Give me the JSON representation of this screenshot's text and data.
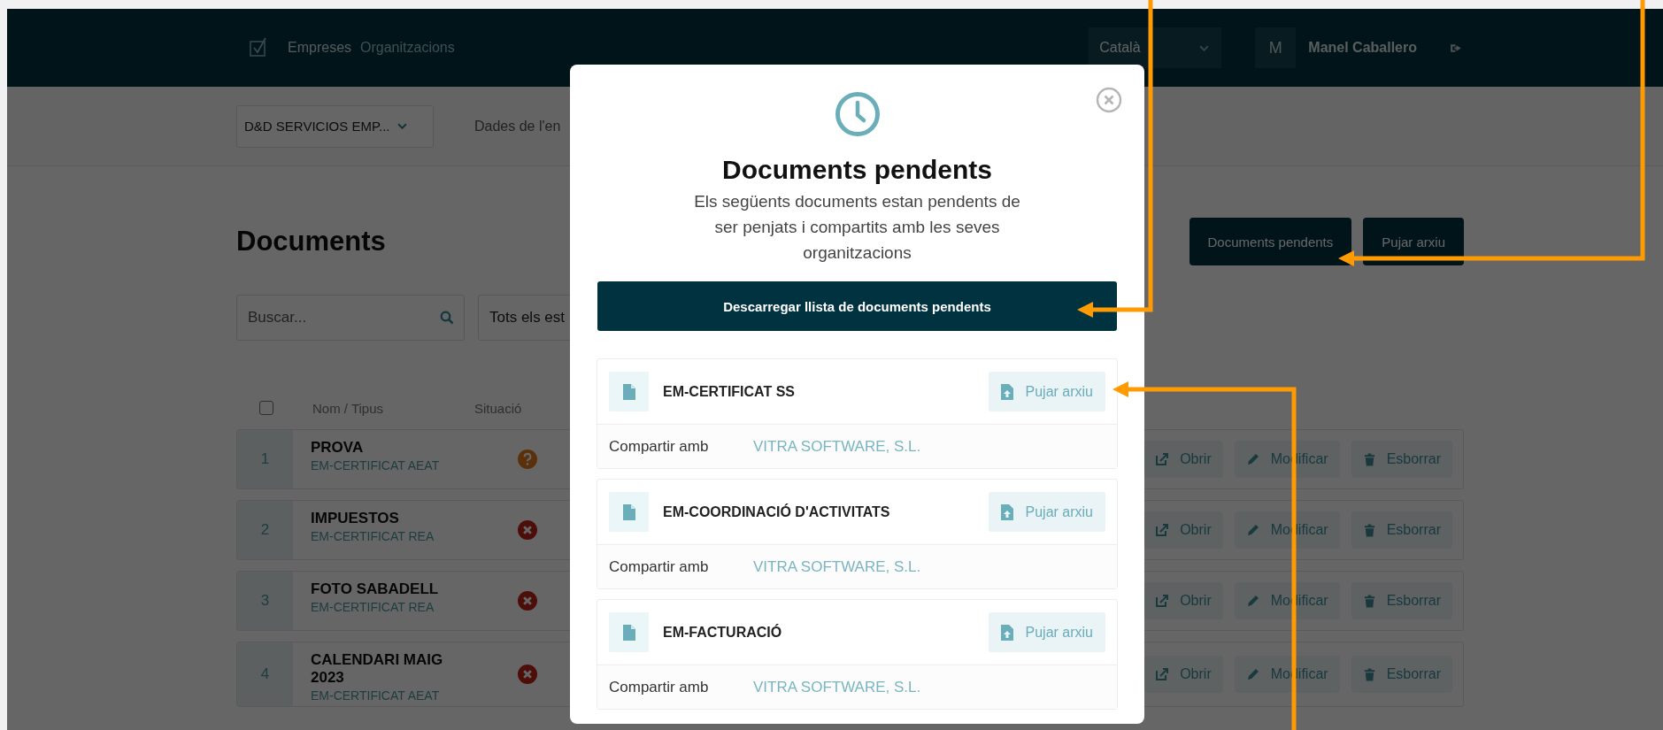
{
  "header": {
    "nav": [
      {
        "label": "Empreses",
        "selected": true
      },
      {
        "label": "Organitzacions",
        "selected": false
      }
    ],
    "language": "Català",
    "user": {
      "initial": "M",
      "name": "Manel Caballero"
    }
  },
  "subbar": {
    "company": "D&D SERVICIOS EMP...",
    "tab": "Dades de l'en"
  },
  "page": {
    "title": "Documents",
    "buttons": [
      "Documents pendents",
      "Pujar arxiu"
    ],
    "search": {
      "placeholder": "Buscar..."
    },
    "filter": "Tots els est"
  },
  "table": {
    "select_all": {
      "checked": false
    },
    "columns": [
      "Nom / Tipus",
      "Situació"
    ],
    "rows": [
      {
        "number": "1",
        "name": "PROVA",
        "type": "EM-CERTIFICAT AEAT",
        "kind": "pending",
        "actions": [
          "Obrir",
          "Modificar",
          "Esborrar"
        ]
      },
      {
        "number": "2",
        "name": "IMPUESTOS",
        "type": "EM-CERTIFICAT REA",
        "kind": "rejected",
        "actions": [
          "Obrir",
          "Modificar",
          "Esborrar"
        ]
      },
      {
        "number": "3",
        "name": "FOTO SABADELL",
        "type": "EM-CERTIFICAT REA",
        "kind": "rejected",
        "actions": [
          "Obrir",
          "Modificar",
          "Esborrar"
        ]
      },
      {
        "number": "4",
        "name": "CALENDARI MAIG 2023",
        "type": "EM-CERTIFICAT AEAT",
        "kind": "rejected",
        "actions": [
          "Obrir",
          "Modificar",
          "Esborrar"
        ]
      }
    ]
  },
  "modal": {
    "title": "Documents pendents",
    "description": "Els següents documents estan pendents de ser penjats i compartits amb les seves organitzacions",
    "download_button": "Descarregar llista de documents pendents",
    "documents": [
      {
        "name": "EM-CERTIFICAT SS",
        "upload_button": "Pujar arxiu",
        "share_label": "Compartir amb",
        "share_with": "VITRA SOFTWARE, S.L."
      },
      {
        "name": "EM-COORDINACIÓ D'ACTIVITATS",
        "upload_button": "Pujar arxiu",
        "share_label": "Compartir amb",
        "share_with": "VITRA SOFTWARE, S.L."
      },
      {
        "name": "EM-FACTURACIÓ",
        "upload_button": "Pujar arxiu",
        "share_label": "Compartir amb",
        "share_with": "VITRA SOFTWARE, S.L."
      }
    ]
  }
}
